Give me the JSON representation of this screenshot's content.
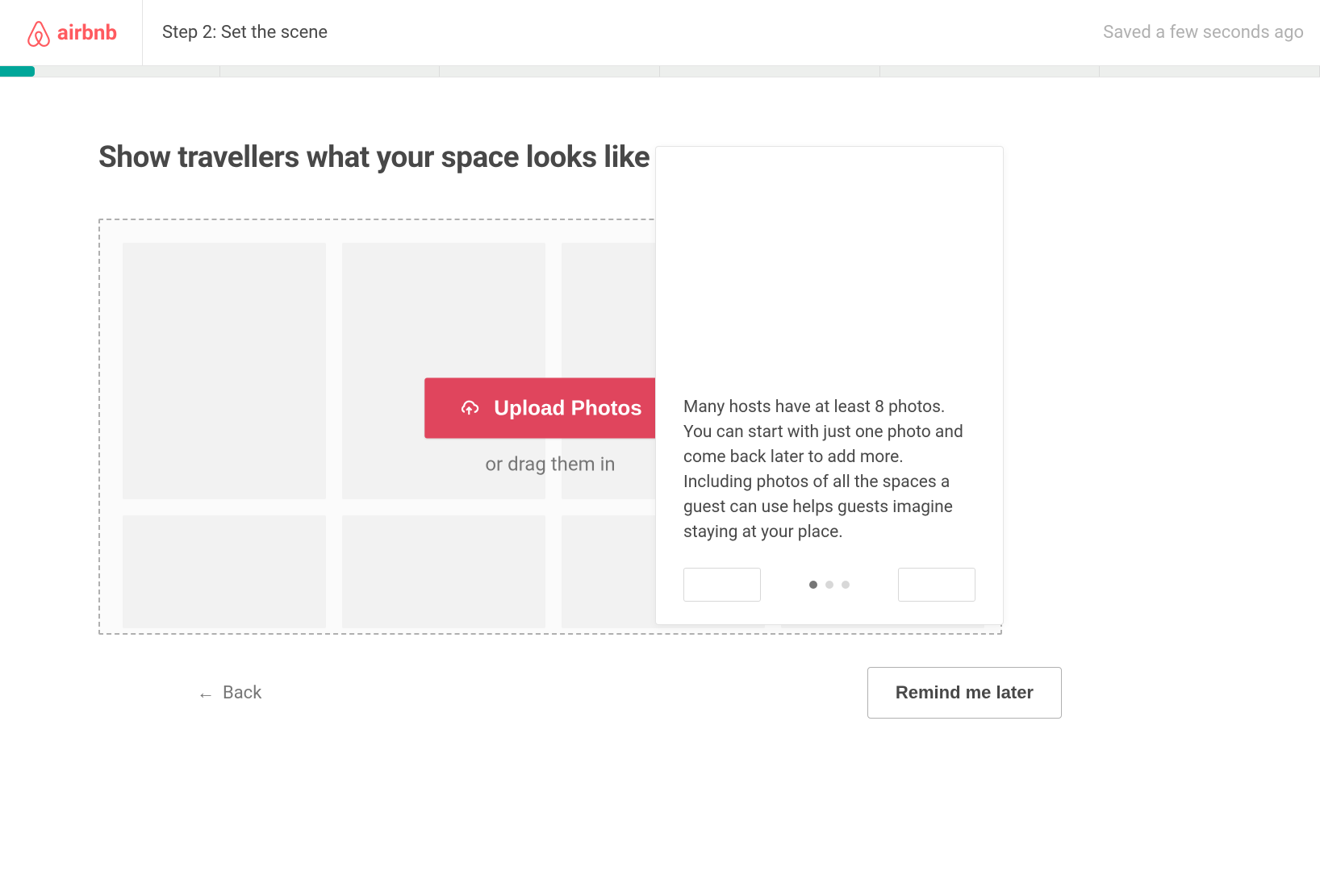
{
  "brand": {
    "name": "airbnb"
  },
  "header": {
    "step_title": "Step 2: Set the scene",
    "saved_text": "Saved a few seconds ago"
  },
  "main": {
    "heading": "Show travellers what your space looks like",
    "upload_button": "Upload Photos",
    "drag_hint": "or drag them in"
  },
  "tips": {
    "text": "Many hosts have at least 8 photos. You can start with just one photo and come back later to add more. Including photos of all the spaces a guest can use helps guests imagine staying at your place."
  },
  "footer": {
    "back": "Back",
    "remind": "Remind me later"
  }
}
